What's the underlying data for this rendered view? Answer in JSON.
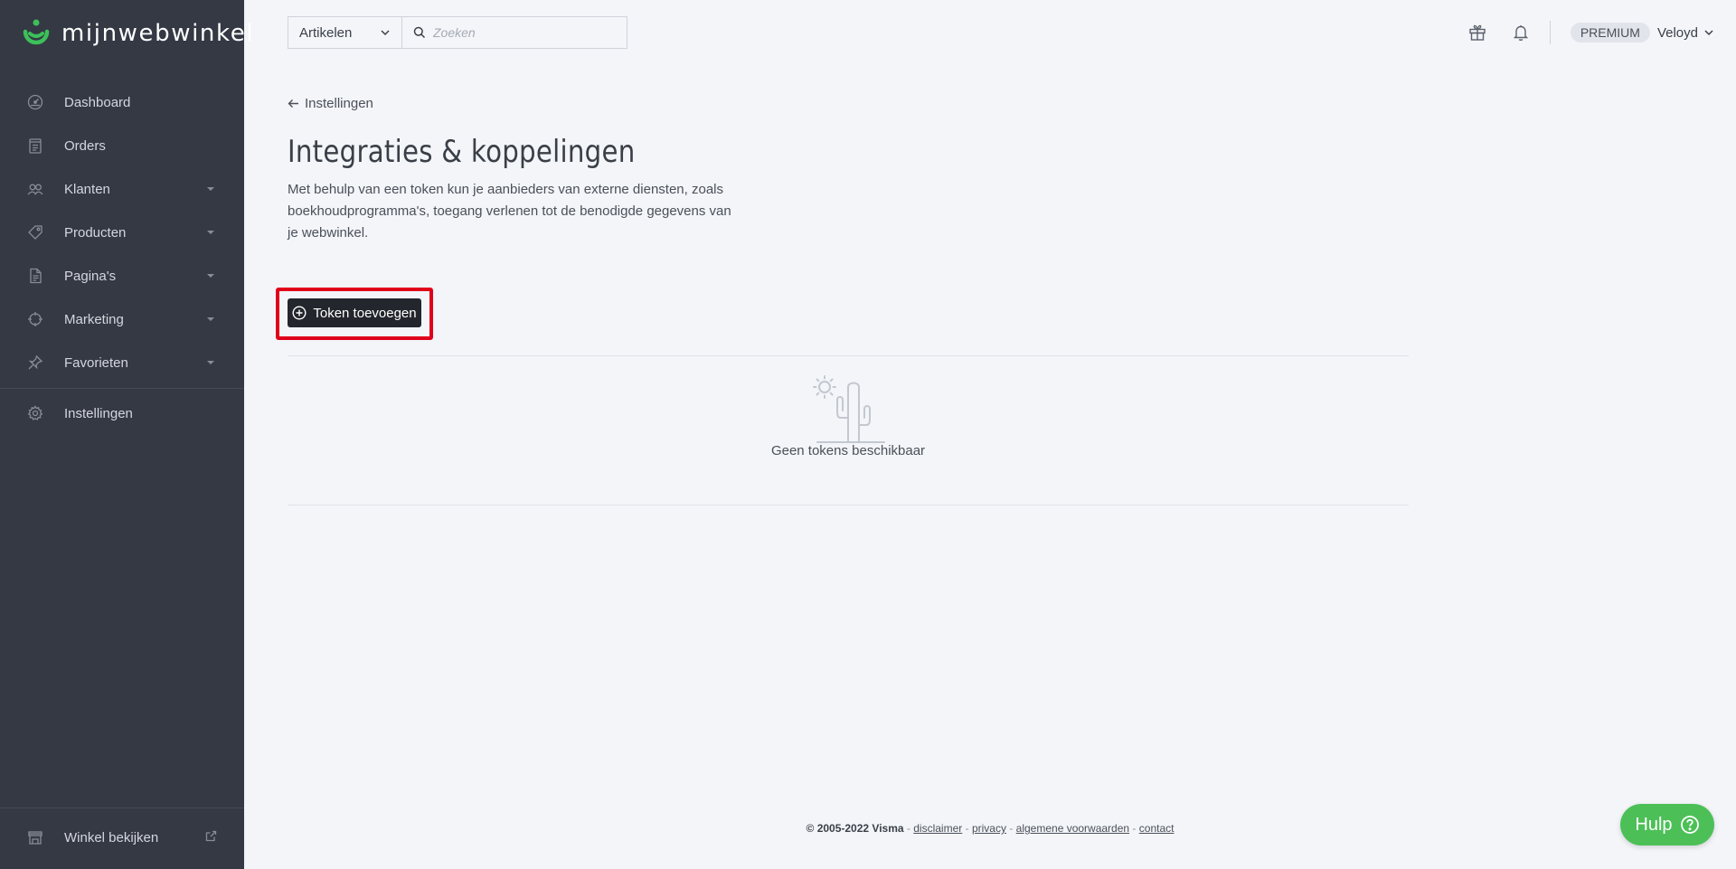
{
  "brand": {
    "name": "mijnwebwinkel",
    "accent": "#3cc05a",
    "icon": "mijnwebwinkel-logo-icon"
  },
  "sidebar": {
    "items": [
      {
        "label": "Dashboard",
        "icon": "dashboard-gauge-icon",
        "expandable": false
      },
      {
        "label": "Orders",
        "icon": "orders-receipt-icon",
        "expandable": false
      },
      {
        "label": "Klanten",
        "icon": "customers-users-icon",
        "expandable": true
      },
      {
        "label": "Producten",
        "icon": "products-tag-icon",
        "expandable": true
      },
      {
        "label": "Pagina's",
        "icon": "pages-document-icon",
        "expandable": true
      },
      {
        "label": "Marketing",
        "icon": "marketing-target-icon",
        "expandable": true
      },
      {
        "label": "Favorieten",
        "icon": "favorites-pin-icon",
        "expandable": true
      },
      {
        "label": "Instellingen",
        "icon": "settings-gear-icon",
        "expandable": false
      }
    ],
    "bottom": {
      "label": "Winkel bekijken",
      "icon": "store-icon",
      "ext_icon": "external-link-icon"
    }
  },
  "topbar": {
    "search_scope": "Artikelen",
    "search_placeholder": "Zoeken",
    "plan_badge": "PREMIUM",
    "user_name": "Veloyd"
  },
  "main": {
    "back_label": "Instellingen",
    "title": "Integraties & koppelingen",
    "description": "Met behulp van een token kun je aanbieders van externe diensten, zoals boekhoudprogramma's, toegang verlenen tot de benodigde gegevens van je webwinkel.",
    "add_button_label": "Token toevoegen",
    "empty_state_text": "Geen tokens beschikbaar",
    "highlight_color": "#e0001a"
  },
  "footer": {
    "copyright": "© 2005-2022 Visma",
    "links": [
      "disclaimer",
      "privacy",
      "algemene voorwaarden",
      "contact"
    ],
    "separator": "-"
  },
  "help": {
    "label": "Hulp",
    "color": "#4cc057"
  }
}
